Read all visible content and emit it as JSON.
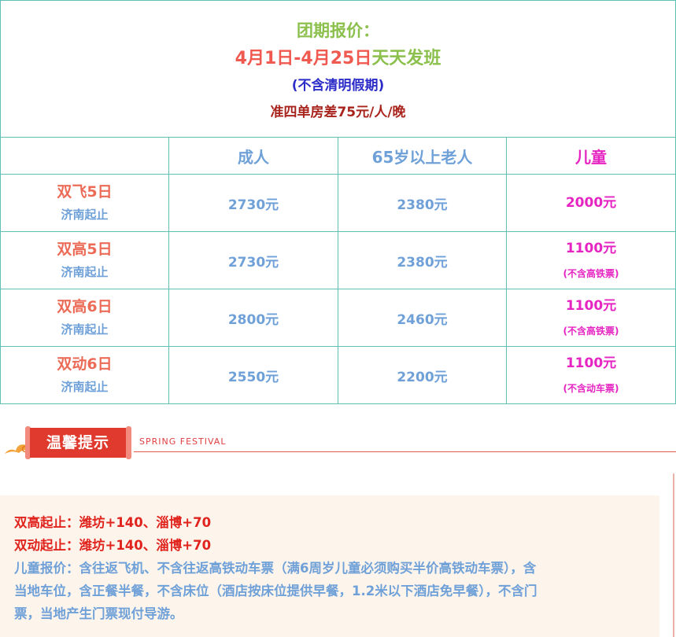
{
  "header": {
    "title": "团期报价：",
    "date_range": "4月1日-4月25日",
    "daily": "天天发班",
    "exclusion": "(不含清明假期)",
    "room_diff": "准四单房差75元/人/晚"
  },
  "columns": {
    "blank": "",
    "adult": "成人",
    "senior": "65岁以上老人",
    "child": "儿童"
  },
  "rows": [
    {
      "route": "双飞5日",
      "from": "济南起止",
      "adult": "2730元",
      "senior": "2380元",
      "child": "2000元",
      "child_note": ""
    },
    {
      "route": "双高5日",
      "from": "济南起止",
      "adult": "2730元",
      "senior": "2380元",
      "child": "1100元",
      "child_note": "(不含高铁票)"
    },
    {
      "route": "双高6日",
      "from": "济南起止",
      "adult": "2800元",
      "senior": "2460元",
      "child": "1100元",
      "child_note": "(不含高铁票)"
    },
    {
      "route": "双动6日",
      "from": "济南起止",
      "adult": "2550元",
      "senior": "2200元",
      "child": "1100元",
      "child_note": "(不含动车票)"
    }
  ],
  "tips": {
    "badge": "温馨提示",
    "subtitle": "SPRING  FESTIVAL"
  },
  "notes": [
    {
      "text": "双高起止：潍坊+140、淄博+70",
      "color": "#e0241d"
    },
    {
      "text": "双动起止：潍坊+140、淄博+70",
      "color": "#e0241d"
    },
    {
      "text": "儿童报价：含往返飞机、不含往返高铁动车票（满6周岁儿童必须购买半价高铁动车票），含",
      "color": "#6fa1d8"
    },
    {
      "text": "当地车位，含正餐半餐，不含床位（酒店按床位提供早餐，1.2米以下酒店免早餐），不含门",
      "color": "#6fa1d8"
    },
    {
      "text": "票，当地产生门票现付导游。",
      "color": "#6fa1d8"
    }
  ]
}
